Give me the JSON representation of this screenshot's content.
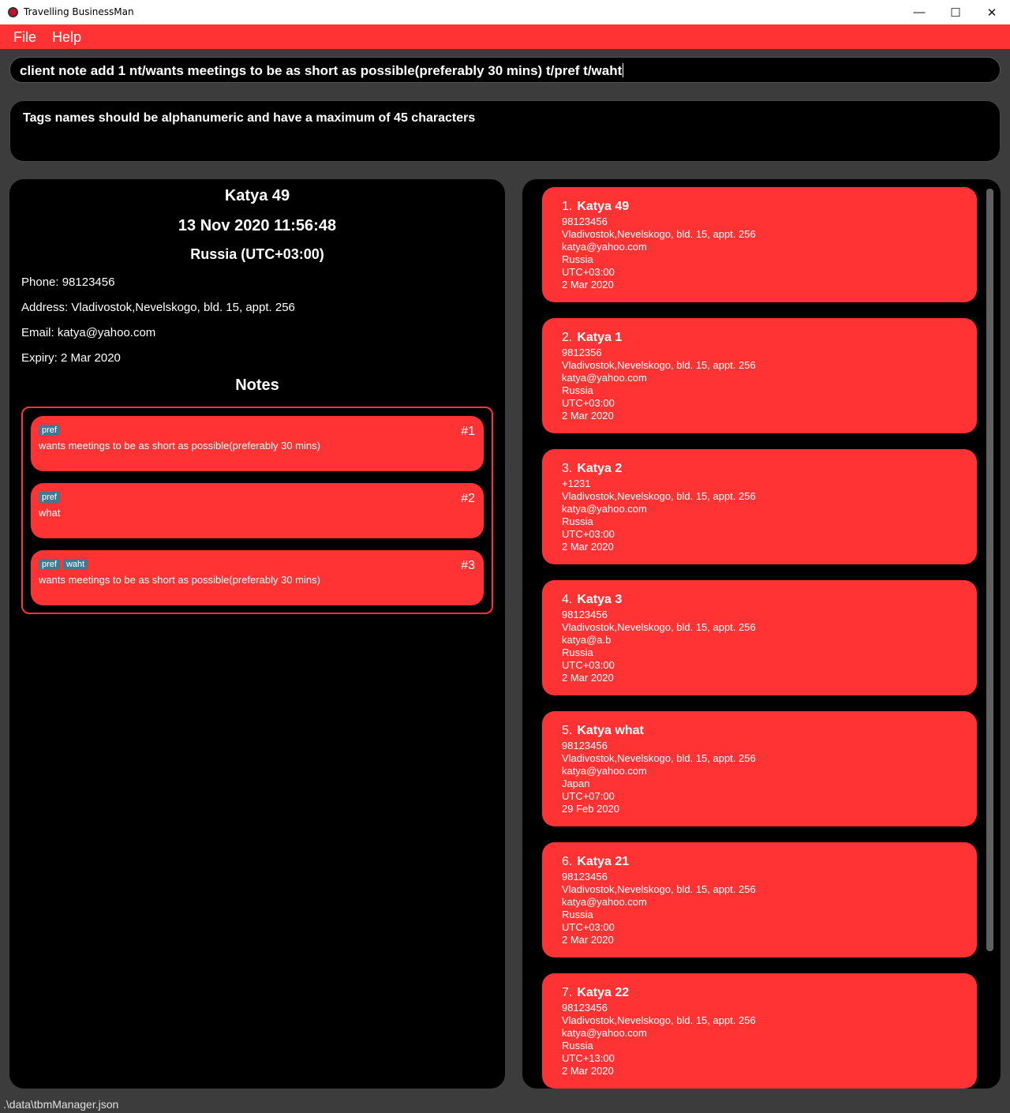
{
  "window": {
    "title": "Travelling BusinessMan",
    "minimize": "—",
    "maximize": "☐",
    "close": "✕"
  },
  "menu": {
    "file": "File",
    "help": "Help"
  },
  "command": {
    "value": "client note add 1 nt/wants meetings to be as short as possible(preferably 30 mins) t/pref t/waht"
  },
  "result": {
    "message": "Tags names should be alphanumeric and have a maximum of 45 characters"
  },
  "detail": {
    "name": "Katya 49",
    "time": "13 Nov 2020 11:56:48",
    "timezone": "Russia (UTC+03:00)",
    "phone": "Phone: 98123456",
    "address": "Address: Vladivostok,Nevelskogo, bld. 15, appt. 256",
    "email": "Email: katya@yahoo.com",
    "expiry": "Expiry: 2 Mar 2020",
    "notes_heading": "Notes"
  },
  "notes": [
    {
      "tags": [
        "pref"
      ],
      "number": "#1",
      "text": "wants meetings to be as short as possible(preferably 30 mins)"
    },
    {
      "tags": [
        "pref"
      ],
      "number": "#2",
      "text": "what"
    },
    {
      "tags": [
        "pref",
        "waht"
      ],
      "number": "#3",
      "text": "wants meetings to be as short as possible(preferably 30 mins)"
    }
  ],
  "clients": [
    {
      "index": "1.",
      "name": "Katya 49",
      "phone": "98123456",
      "address": "Vladivostok,Nevelskogo, bld. 15, appt. 256",
      "email": "katya@yahoo.com",
      "country": "Russia",
      "tz": "UTC+03:00",
      "expiry": "2 Mar 2020"
    },
    {
      "index": "2.",
      "name": "Katya 1",
      "phone": "9812356",
      "address": "Vladivostok,Nevelskogo, bld. 15, appt. 256",
      "email": "katya@yahoo.com",
      "country": "Russia",
      "tz": "UTC+03:00",
      "expiry": "2 Mar 2020"
    },
    {
      "index": "3.",
      "name": "Katya 2",
      "phone": "+1231",
      "address": "Vladivostok,Nevelskogo, bld. 15, appt. 256",
      "email": "katya@yahoo.com",
      "country": "Russia",
      "tz": "UTC+03:00",
      "expiry": "2 Mar 2020"
    },
    {
      "index": "4.",
      "name": "Katya 3",
      "phone": "98123456",
      "address": "Vladivostok,Nevelskogo, bld. 15, appt. 256",
      "email": "katya@a.b",
      "country": "Russia",
      "tz": "UTC+03:00",
      "expiry": "2 Mar 2020"
    },
    {
      "index": "5.",
      "name": "Katya what",
      "phone": "98123456",
      "address": "Vladivostok,Nevelskogo, bld. 15, appt. 256",
      "email": "katya@yahoo.com",
      "country": "Japan",
      "tz": "UTC+07:00",
      "expiry": "29 Feb 2020"
    },
    {
      "index": "6.",
      "name": "Katya 21",
      "phone": "98123456",
      "address": "Vladivostok,Nevelskogo, bld. 15, appt. 256",
      "email": "katya@yahoo.com",
      "country": "Russia",
      "tz": "UTC+03:00",
      "expiry": "2 Mar 2020"
    },
    {
      "index": "7.",
      "name": "Katya 22",
      "phone": "98123456",
      "address": "Vladivostok,Nevelskogo, bld. 15, appt. 256",
      "email": "katya@yahoo.com",
      "country": "Russia",
      "tz": "UTC+13:00",
      "expiry": "2 Mar 2020"
    }
  ],
  "status": {
    "path": ".\\data\\tbmManager.json"
  }
}
